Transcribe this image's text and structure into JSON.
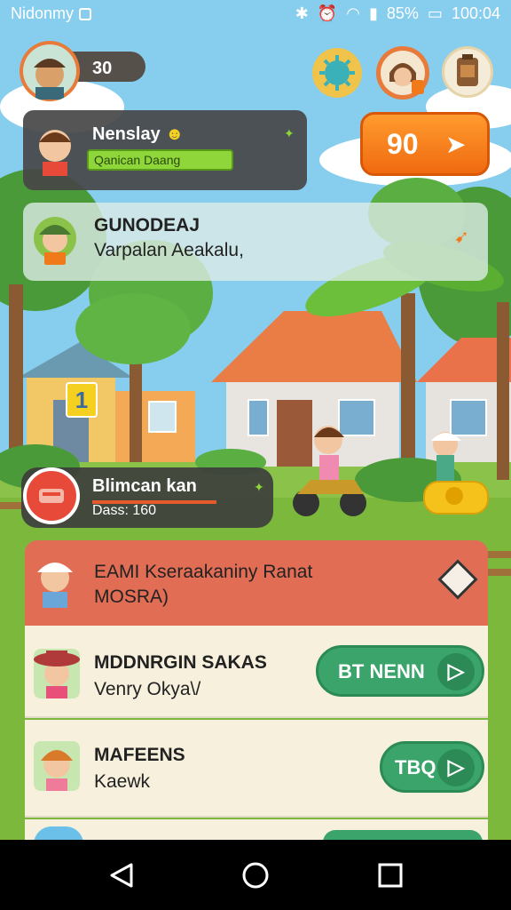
{
  "status_bar": {
    "app_name": "Nidonmy",
    "battery": "85%",
    "time": "100:04"
  },
  "header": {
    "coins": "30",
    "go_value": "90"
  },
  "player": {
    "name": "Nenslay",
    "xp_label": "Qanican Daang"
  },
  "notice": {
    "title": "GUNODEAJ",
    "subtitle": "Varpalan Aeakalu,"
  },
  "house_badge": "1",
  "quest": {
    "title": "Blimcan kan",
    "subtitle": "Dass: 160"
  },
  "list": {
    "header_title": "EAMI Kseraakaniny Ranat",
    "header_sub": "MOSRA)",
    "items": [
      {
        "title": "MDDNRGIN SAKAS",
        "subtitle": "Venry Okya\\/",
        "button": "BT NENN"
      },
      {
        "title": "MAFEENS",
        "subtitle": "Kaewk",
        "button": "TBQ"
      }
    ]
  },
  "colors": {
    "accent_orange": "#f07a1a",
    "accent_green": "#3aa46a",
    "header_red": "#e26d55"
  }
}
